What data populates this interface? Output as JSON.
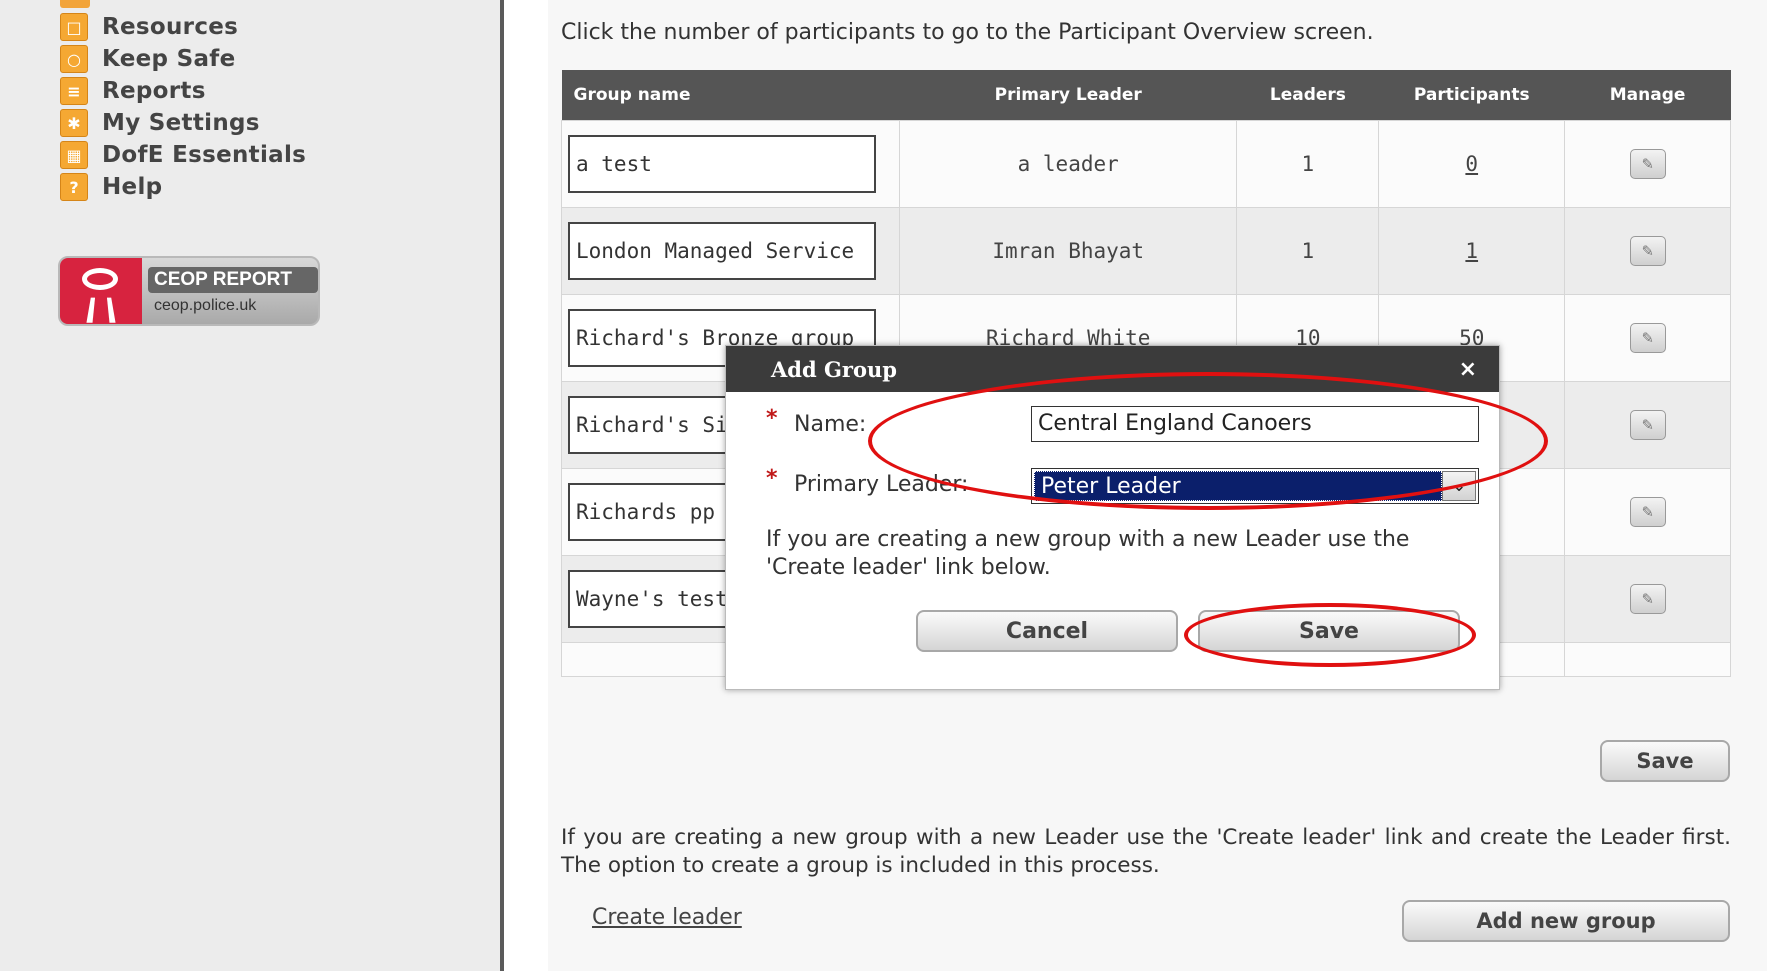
{
  "sidebar": {
    "items": [
      {
        "label": "Resources",
        "icon": "folder-icon"
      },
      {
        "label": "Keep Safe",
        "icon": "lock-icon"
      },
      {
        "label": "Reports",
        "icon": "document-icon"
      },
      {
        "label": "My Settings",
        "icon": "settings-icon"
      },
      {
        "label": "DofE Essentials",
        "icon": "shop-icon"
      },
      {
        "label": "Help",
        "icon": "question-icon"
      }
    ],
    "ceop": {
      "title": "CEOP REPORT",
      "url": "ceop.police.uk"
    }
  },
  "main": {
    "instructions": "Click the number of participants to go to the Participant Overview screen.",
    "table": {
      "headers": [
        "Group name",
        "Primary Leader",
        "Leaders",
        "Participants",
        "Manage"
      ],
      "rows": [
        {
          "name": "a test",
          "leader": "a leader",
          "leaders": "1",
          "participants": "0"
        },
        {
          "name": "London Managed Service",
          "leader": "Imran Bhayat",
          "leaders": "1",
          "participants": "1"
        },
        {
          "name": "Richard's Bronze group",
          "leader": "Richard White",
          "leaders": "10",
          "participants": "50"
        },
        {
          "name": "Richard's Sil",
          "leader": "",
          "leaders": "",
          "participants": ""
        },
        {
          "name": "Richards pp",
          "leader": "",
          "leaders": "",
          "participants": ""
        },
        {
          "name": "Wayne's test",
          "leader": "",
          "leaders": "",
          "participants": ""
        }
      ]
    },
    "save_label": "Save",
    "footer_note": "If you are creating a new group with a new Leader use the 'Create leader' link and create the Leader first. The option to create a group is included in this process.",
    "create_leader_label": "Create leader",
    "add_new_group_label": "Add new group"
  },
  "modal": {
    "title": "Add Group",
    "close": "×",
    "name_label": "Name:",
    "name_value": "Central England Canoers",
    "leader_label": "Primary Leader:",
    "leader_value": "Peter Leader",
    "required_mark": "*",
    "help_text": "If you are creating a new group with a new Leader use the 'Create leader' link below.",
    "cancel_label": "Cancel",
    "save_label": "Save"
  },
  "colors": {
    "header_bg": "#555555",
    "modal_header_bg": "#3b3b3b",
    "annotation": "#e01010",
    "select_highlight": "#0b1f6b",
    "nav_icon": "#f5a833"
  }
}
